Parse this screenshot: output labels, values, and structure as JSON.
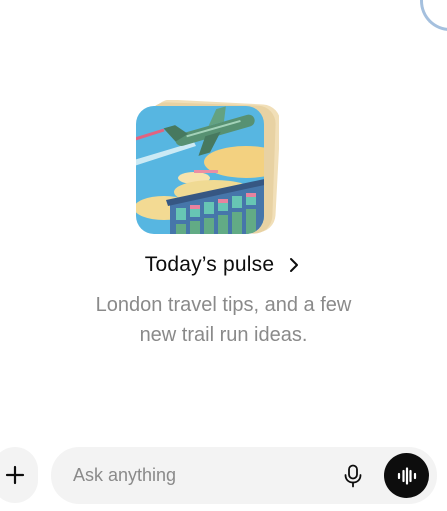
{
  "pulse": {
    "title": "Today’s pulse",
    "subtitle_line1": "London travel tips, and a few",
    "subtitle_line2": "new trail run ideas.",
    "illustration": "airplane-over-terminal-illustration"
  },
  "composer": {
    "placeholder": "Ask anything",
    "icons": [
      "plus-icon",
      "microphone-icon",
      "voice-waveform-icon"
    ]
  },
  "colors": {
    "background": "#ffffff",
    "composer_bg": "#f3f3f3",
    "title_text": "#0d0d0d",
    "subtitle_text": "#8a8a8a",
    "voice_button": "#0d0d0d",
    "sky": "#4fb3e0",
    "plane": "#4e8c6b"
  }
}
